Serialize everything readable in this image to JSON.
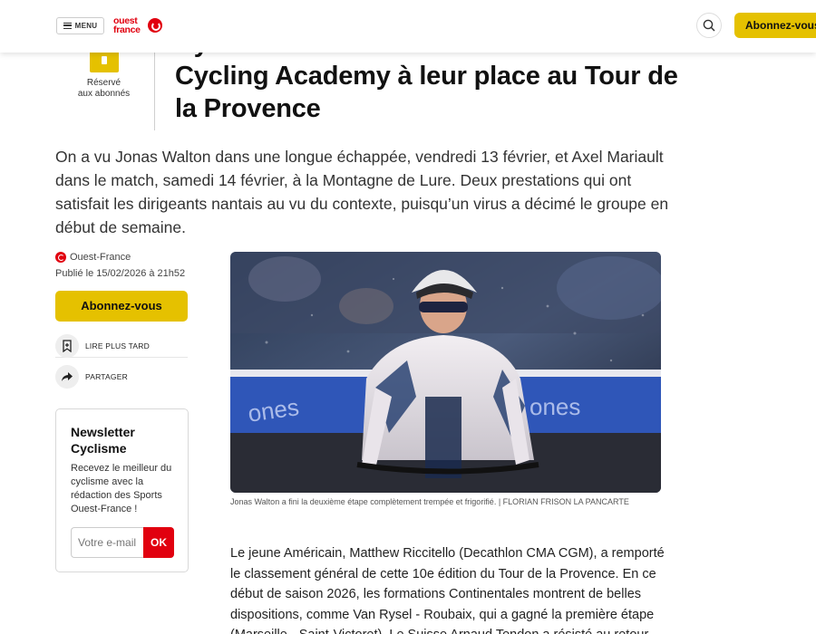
{
  "header": {
    "menu_label": "MENU",
    "logo_text_line1": "ouest",
    "logo_text_line2": "france",
    "subscribe_label": "Abonnez-vous"
  },
  "article": {
    "premium_badge": {
      "line1": "Réservé",
      "line2": "aux abonnés"
    },
    "headline": "Cyclisme. Axel Mariault et le CIC Pro Cycling Academy à leur place au Tour de la Provence",
    "lede": "On a vu Jonas Walton dans une longue échappée, vendredi 13 février, et Axel Mariault dans le match, samedi 14 février, à la Montagne de Lure. Deux prestations qui ont satisfait les dirigeants nantais au vu du contexte, puisqu’un virus a décimé le groupe en début de semaine.",
    "source": "Ouest-France",
    "published": "Publié le 15/02/2026 à 21h52",
    "subscribe_label": "Abonnez-vous",
    "actions": [
      {
        "label": "LIRE PLUS TARD",
        "icon": "bookmark-icon"
      },
      {
        "label": "PARTAGER",
        "icon": "share-icon"
      }
    ],
    "photo_caption": "Jonas Walton a fini la deuxième étape complètement trempée et frigorifié. | FLORIAN FRISON LA PANCARTE",
    "body": "Le jeune Américain, Matthew Riccitello (Decathlon CMA CGM), a remporté le classement général de cette 10e édition du Tour de la Provence. En ce début de saison 2026, les formations Continentales montrent de belles dispositions, comme Van Rysel - Roubaix, qui a gagné la première étape (Marseille - Saint-Victoret). Le Suisse Arnaud Tendon a résisté au retour du peloton,"
  },
  "newsletter": {
    "title": "Newsletter Cyclisme",
    "text": "Recevez le meilleur du cyclisme avec la rédaction des Sports Ouest-France !",
    "email_placeholder": "Votre e-mail",
    "submit_label": "OK"
  },
  "colors": {
    "brand_red": "#e1000f",
    "subscribe_yellow": "#e5c100"
  }
}
